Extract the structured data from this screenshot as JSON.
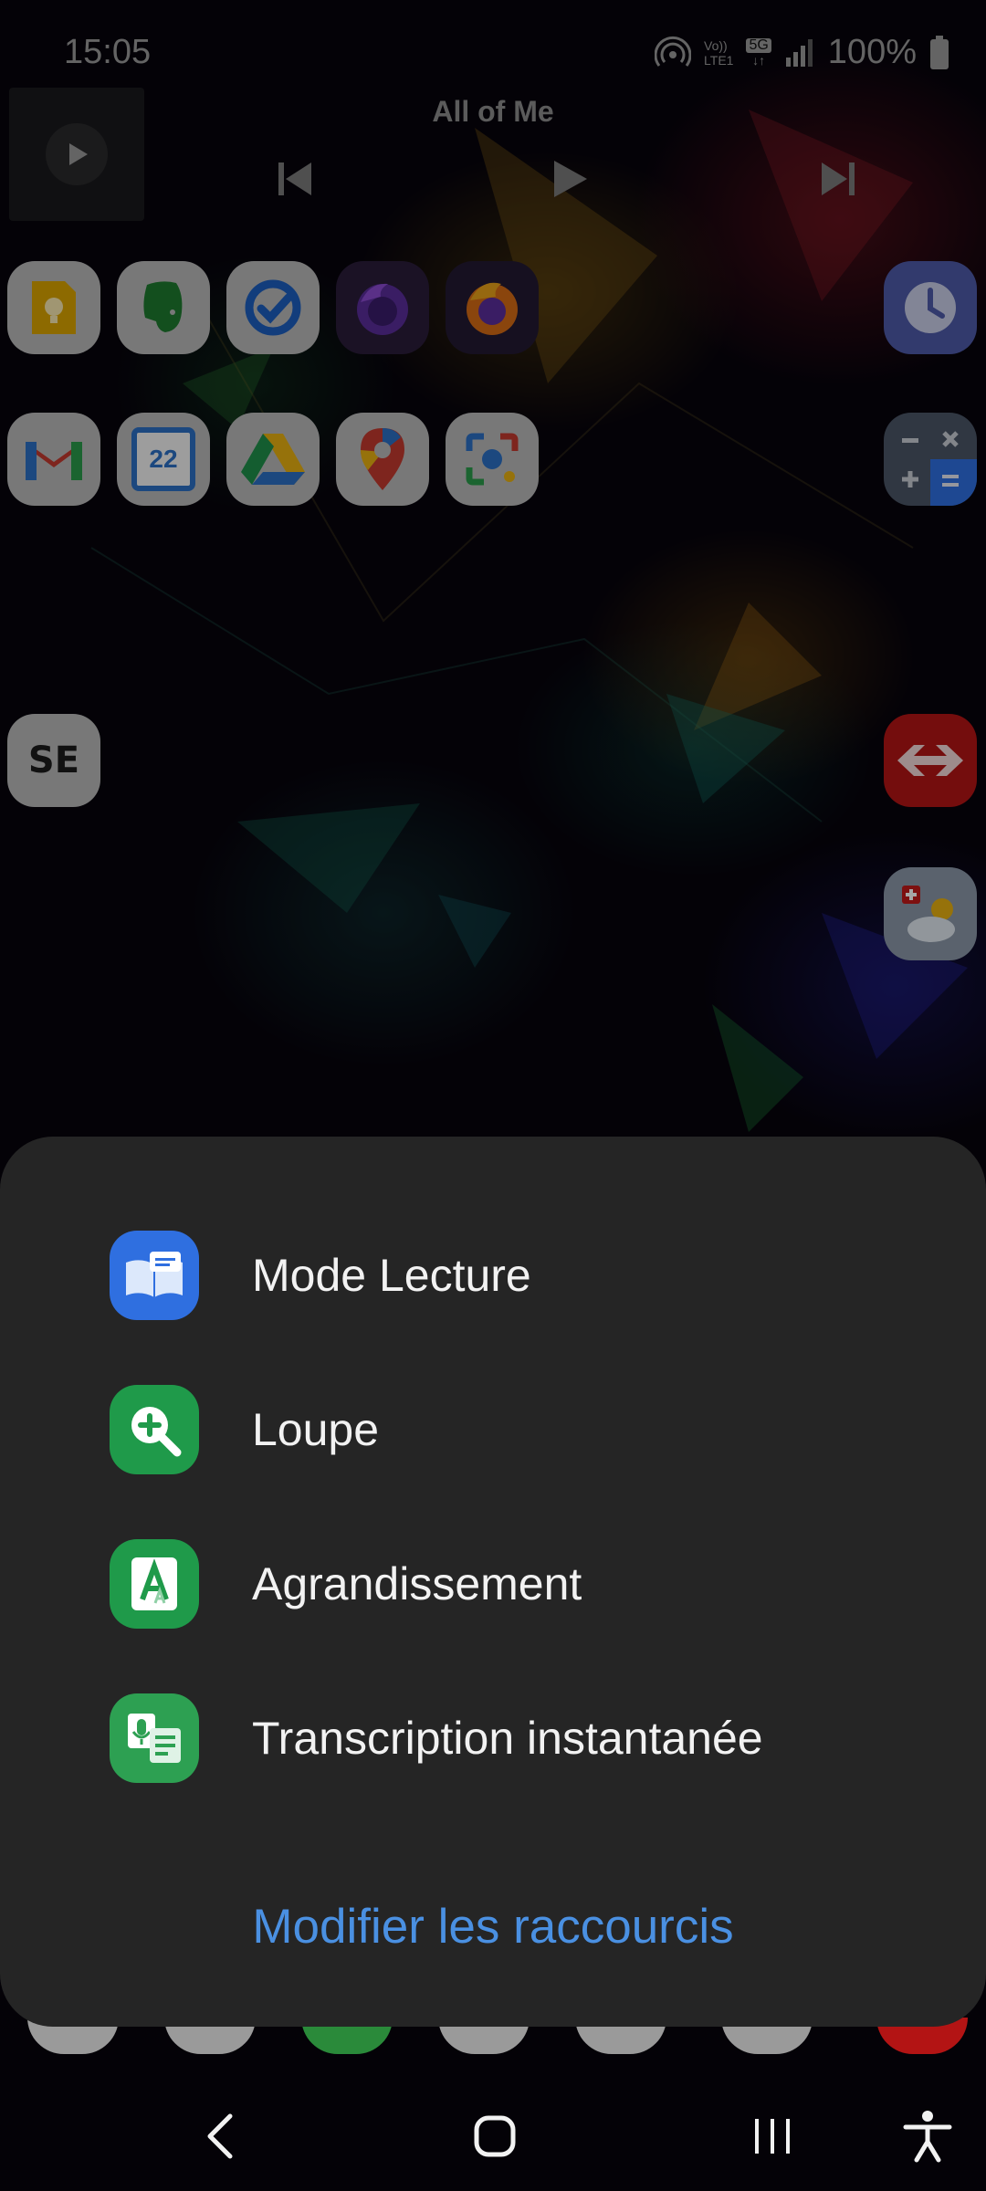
{
  "status_bar": {
    "time": "15:05",
    "network_voi": "Vo))",
    "network_lte": "LTE1",
    "network_5g": "5G",
    "battery": "100%"
  },
  "media": {
    "title": "All of Me"
  },
  "home_apps": {
    "row1": [
      "keep-icon",
      "evernote-icon",
      "todo-icon",
      "firefox-nightly-icon",
      "firefox-icon"
    ],
    "row2": [
      "gmail-icon",
      "calendar-icon",
      "drive-icon",
      "maps-icon",
      "lens-icon"
    ],
    "calendar_day": "22",
    "se_text": "SE"
  },
  "sheet": {
    "items": [
      {
        "label": "Mode Lecture",
        "icon": "reading-mode-icon",
        "color": "#2f6fe0"
      },
      {
        "label": "Loupe",
        "icon": "magnifier-icon",
        "color": "#1f9a4a"
      },
      {
        "label": "Agrandissement",
        "icon": "magnification-icon",
        "color": "#1f9a4a"
      },
      {
        "label": "Transcription instantanée",
        "icon": "live-transcribe-icon",
        "color": "#2da052"
      }
    ],
    "edit_label": "Modifier les raccourcis"
  },
  "colors": {
    "sheet_bg": "#252525",
    "accent_link": "#4a90e2"
  }
}
